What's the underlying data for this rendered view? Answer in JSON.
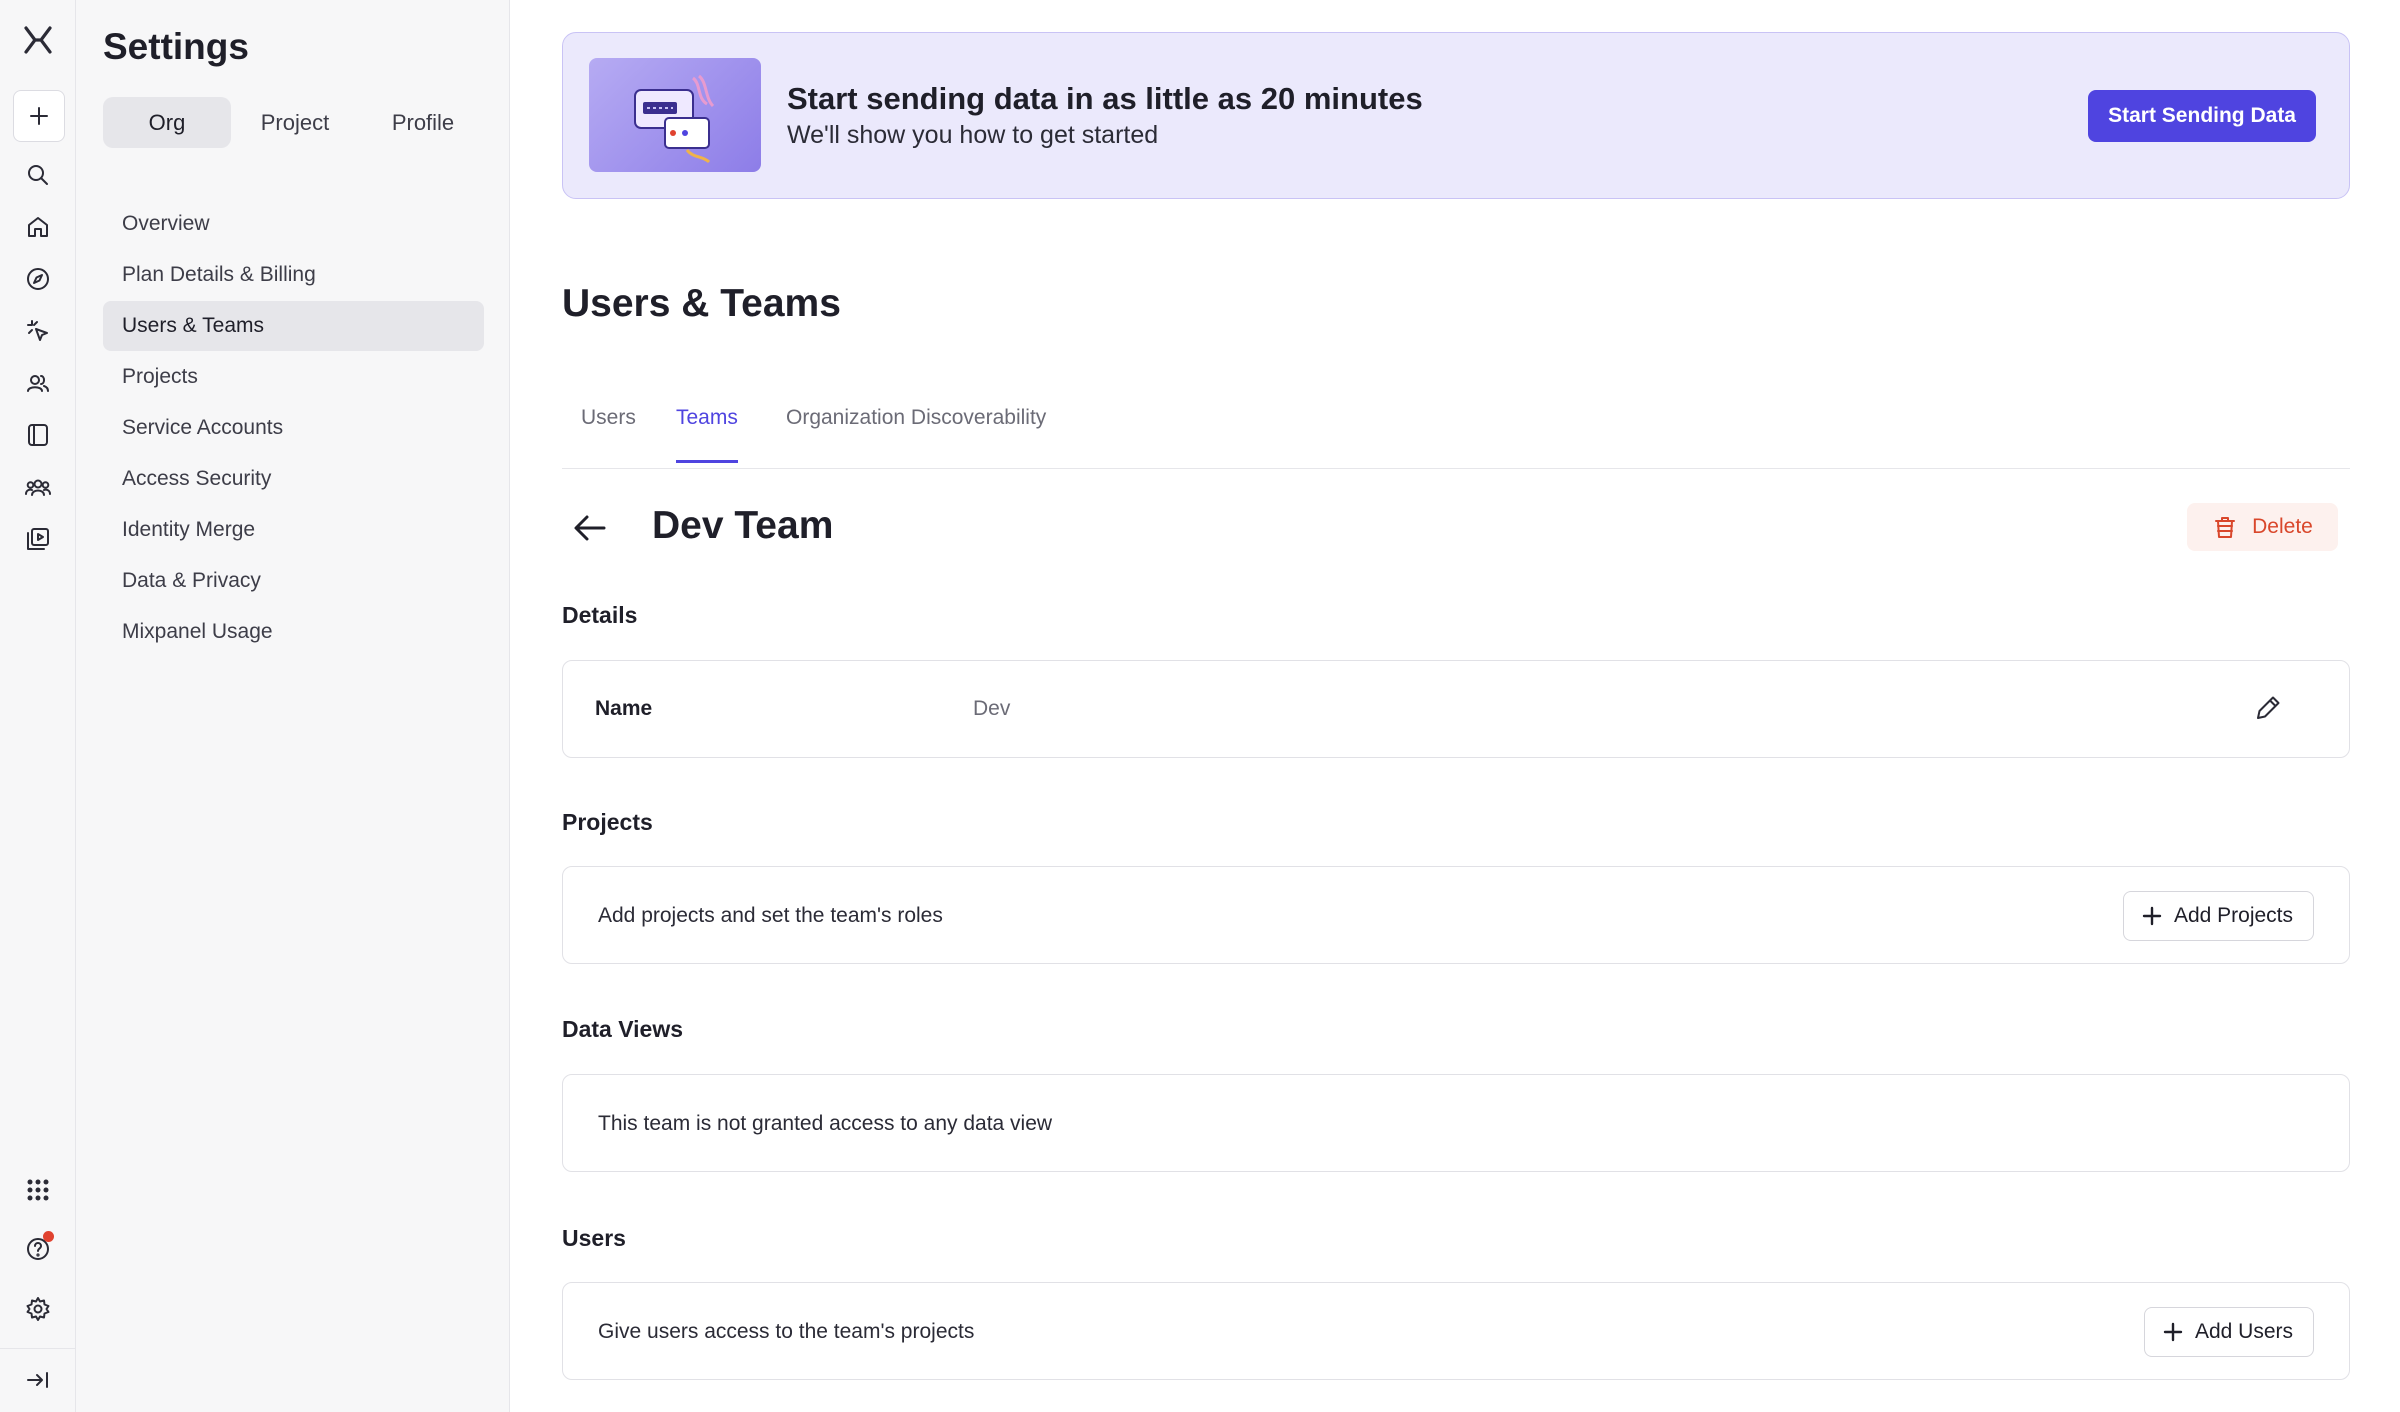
{
  "rail": {
    "items": [
      "mixpanel-logo",
      "create",
      "search",
      "home",
      "discover",
      "session-replay",
      "users",
      "boards",
      "cohorts",
      "replays"
    ],
    "bottom": [
      "apps",
      "help",
      "settings",
      "collapse"
    ]
  },
  "sidebar": {
    "title": "Settings",
    "scope_tabs": [
      "Org",
      "Project",
      "Profile"
    ],
    "items": [
      {
        "label": "Overview"
      },
      {
        "label": "Plan Details & Billing"
      },
      {
        "label": "Users & Teams"
      },
      {
        "label": "Projects"
      },
      {
        "label": "Service Accounts"
      },
      {
        "label": "Access Security"
      },
      {
        "label": "Identity Merge"
      },
      {
        "label": "Data & Privacy"
      },
      {
        "label": "Mixpanel Usage"
      }
    ]
  },
  "banner": {
    "title": "Start sending data in as little as 20 minutes",
    "subtitle": "We'll show you how to get started",
    "button": "Start Sending Data"
  },
  "page": {
    "title": "Users & Teams",
    "tabs": [
      "Users",
      "Teams",
      "Organization Discoverability"
    ],
    "active_tab": "Teams"
  },
  "team": {
    "title": "Dev Team",
    "delete_label": "Delete",
    "details": {
      "label": "Details",
      "name_label": "Name",
      "name_value": "Dev"
    },
    "projects": {
      "label": "Projects",
      "text": "Add projects and set the team's roles",
      "button": "Add Projects"
    },
    "data_views": {
      "label": "Data Views",
      "text": "This team is not granted access to any data view"
    },
    "users": {
      "label": "Users",
      "text": "Give users access to the team's projects",
      "button": "Add Users"
    }
  },
  "colors": {
    "accent": "#4f44e0",
    "danger": "#d9472b",
    "banner_bg": "#ebe9fc",
    "notification": "#e0422f"
  }
}
